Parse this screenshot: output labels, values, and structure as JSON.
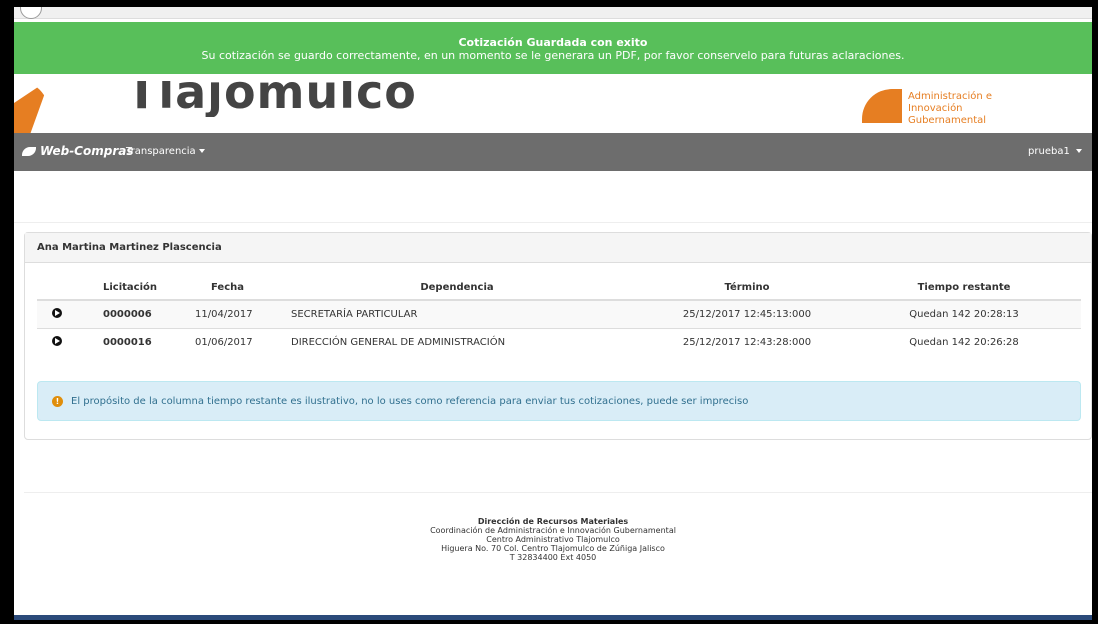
{
  "notification": {
    "title": "Cotización Guardada con exito",
    "body": "Su cotización se guardo correctamente, en un momento se le generara un PDF, por favor conservelo para futuras aclaraciones."
  },
  "header": {
    "logo_text": "Tlajomulco",
    "coord_text_line1": "Administración e",
    "coord_text_line2": "Innovación Gubernamental"
  },
  "navbar": {
    "brand": "Web-Compras",
    "transparencia": "Transparencia",
    "user": "prueba1"
  },
  "panel": {
    "heading": "Ana Martina Martinez Plascencia",
    "columns": [
      "Licitación",
      "Fecha",
      "Dependencia",
      "Término",
      "Tiempo restante"
    ],
    "rows": [
      {
        "licitacion": "0000006",
        "fecha": "11/04/2017",
        "dependencia": "SECRETARÍA PARTICULAR",
        "termino": "25/12/2017 12:45:13:000",
        "tiempo": "Quedan 142 20:28:13"
      },
      {
        "licitacion": "0000016",
        "fecha": "01/06/2017",
        "dependencia": "DIRECCIÓN GENERAL DE ADMINISTRACIÓN",
        "termino": "25/12/2017 12:43:28:000",
        "tiempo": "Quedan 142 20:26:28"
      }
    ],
    "info": "El propósito de la columna tiempo restante es ilustrativo, no lo uses como referencia para enviar tus cotizaciones, puede ser impreciso"
  },
  "footer": {
    "title": "Dirección de Recursos Materiales",
    "line1": "Coordinación de Administración e Innovación Gubernamental",
    "line2": "Centro Administrativo Tlajomulco",
    "line3": "Higuera No. 70 Col. Centro Tlajomulco de Zúñiga Jalisco",
    "line4": "T 32834400 Ext 4050"
  },
  "colors": {
    "notification": "#58bf5a",
    "navbar": "#6d6d6d",
    "accent": "#e67e22",
    "info_bg": "#d9edf7"
  }
}
